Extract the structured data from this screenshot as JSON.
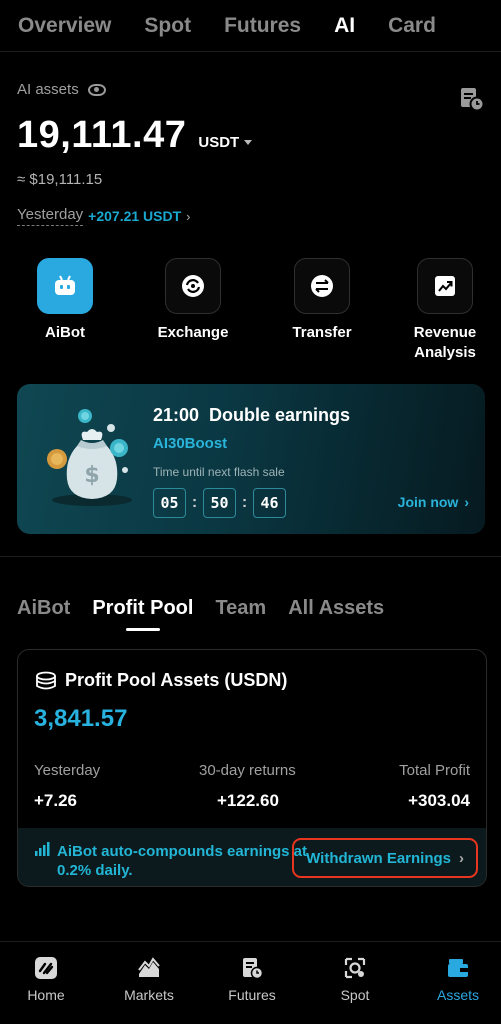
{
  "top_tabs": [
    "Overview",
    "Spot",
    "Futures",
    "AI",
    "Card"
  ],
  "assets": {
    "label": "AI assets",
    "balance": "19,111.47",
    "unit": "USDT",
    "approx": "≈ $19,111.15",
    "yesterday_label": "Yesterday",
    "yesterday_value": "+207.21 USDT"
  },
  "actions": [
    {
      "label": "AiBot",
      "icon": "robot-icon"
    },
    {
      "label": "Exchange",
      "icon": "exchange-icon"
    },
    {
      "label": "Transfer",
      "icon": "transfer-icon"
    },
    {
      "label": "Revenue\nAnalysis",
      "icon": "trend-chart-icon"
    }
  ],
  "banner": {
    "title": "21:00  Double earnings",
    "code": "AI30Boost",
    "note": "Time until next flash sale",
    "countdown": [
      "05",
      "50",
      "46"
    ],
    "join": "Join now"
  },
  "sub_tabs": [
    "AiBot",
    "Profit Pool",
    "Team",
    "All Assets"
  ],
  "pool": {
    "title": "Profit Pool Assets (USDN)",
    "value": "3,841.57",
    "stats": [
      {
        "label": "Yesterday",
        "value": "+7.26"
      },
      {
        "label": "30-day returns",
        "value": "+122.60"
      },
      {
        "label": "Total Profit",
        "value": "+303.04"
      }
    ],
    "footer_note": "AiBot auto-compounds earnings at 0.2% daily.",
    "withdrawn_label": "Withdrawn Earnings"
  },
  "bottom_nav": [
    "Home",
    "Markets",
    "Futures",
    "Spot",
    "Assets"
  ],
  "colors": {
    "accent": "#2aa8e0",
    "highlight_border": "#e8351f",
    "background": "#000000"
  }
}
